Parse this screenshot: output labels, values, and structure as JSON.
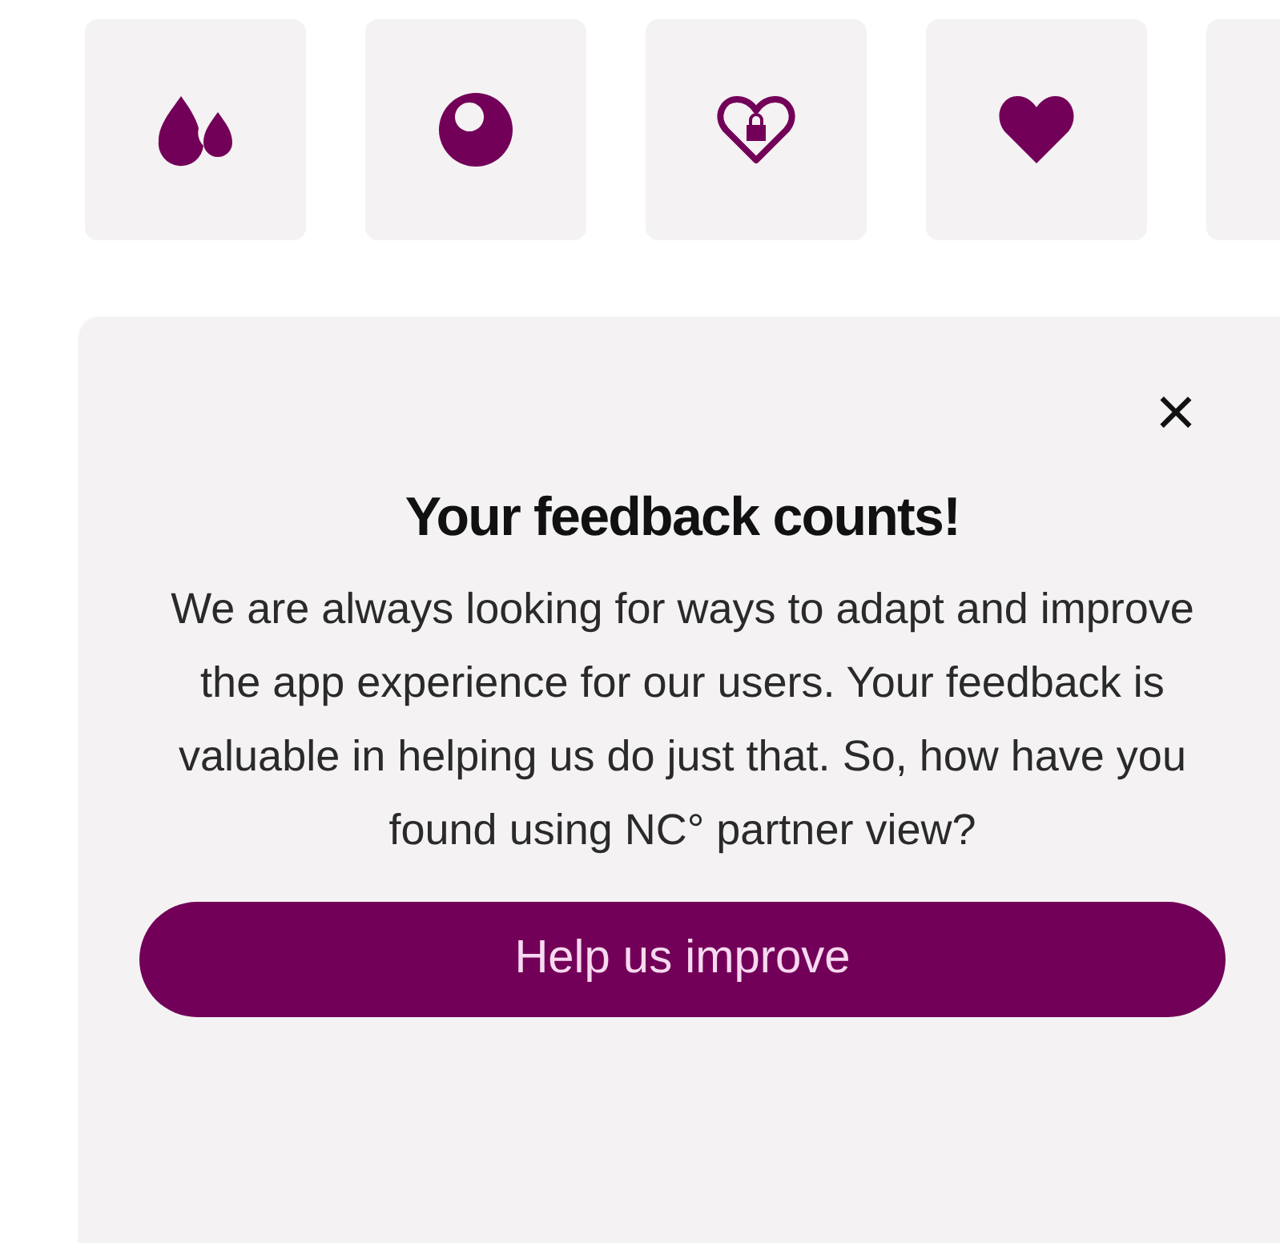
{
  "tiles": [
    {
      "kind": "drops"
    },
    {
      "kind": "circle"
    },
    {
      "kind": "heart-lock"
    },
    {
      "kind": "heart"
    }
  ],
  "feedback_card": {
    "close_label": "×",
    "title": "Your feedback counts!",
    "body": "We are always looking for ways to adapt and improve the app experience for our users. Your feedback is valuable in helping us do just that. So, how have you found using NC° partner view?",
    "button": "Help us improve"
  }
}
